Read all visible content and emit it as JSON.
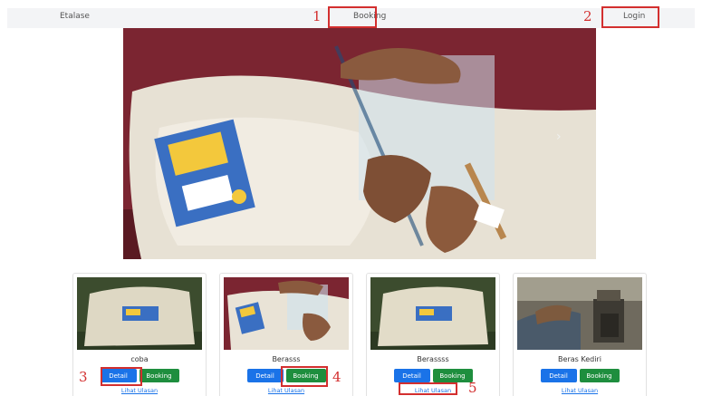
{
  "navbar": {
    "brand": "Etalase",
    "booking": "Booking",
    "login": "Login"
  },
  "callouts": [
    "1",
    "2",
    "3",
    "4",
    "5"
  ],
  "carousel": {
    "next_icon": "chevron-right-icon",
    "next_glyph": "›",
    "slide_count": 3,
    "active_slide": 1
  },
  "products": [
    {
      "name": "coba",
      "detail": "Detail",
      "booking": "Booking",
      "review": "Lihat Ulasan"
    },
    {
      "name": "Berasss",
      "detail": "Detail",
      "booking": "Booking",
      "review": "Lihat Ulasan"
    },
    {
      "name": "Berassss",
      "detail": "Detail",
      "booking": "Booking",
      "review": "Lihat Ulasan"
    },
    {
      "name": "Beras Kediri",
      "detail": "Detail",
      "booking": "Booking",
      "review": "Lihat Ulasan"
    }
  ],
  "colors": {
    "detail_button": "#1a73e8",
    "booking_button": "#1e8e3e",
    "callout": "#d32f2f",
    "navbar_bg": "#f3f4f6"
  }
}
